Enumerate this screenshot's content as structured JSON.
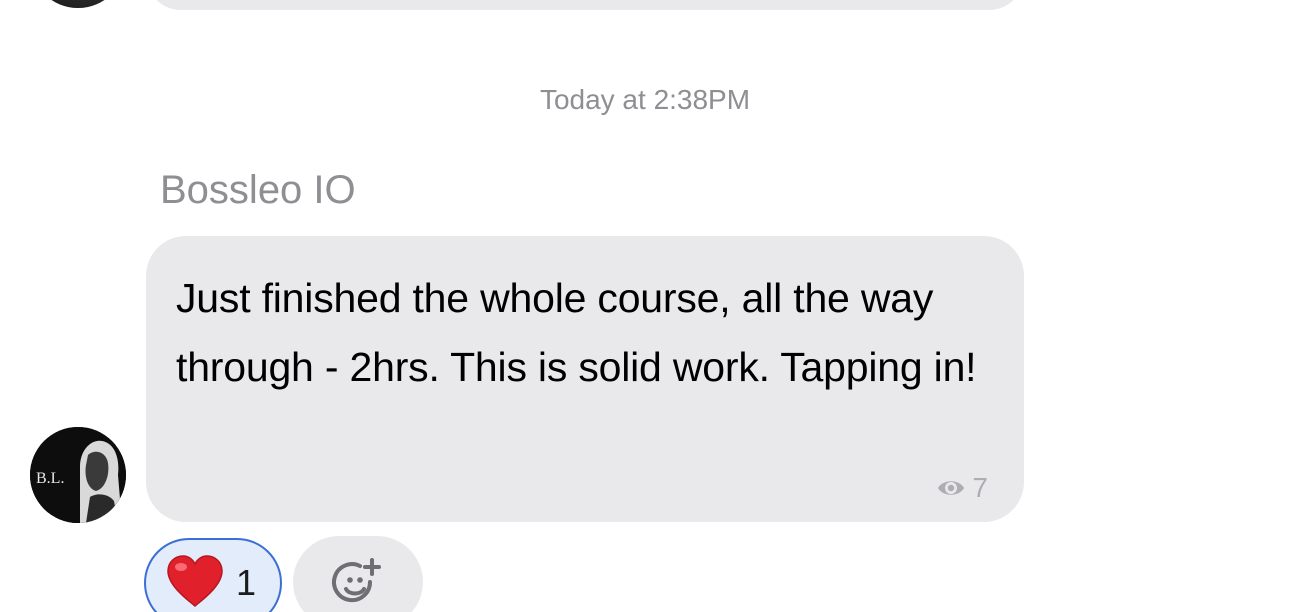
{
  "conversation": {
    "timestamp": "Today at 2:38PM",
    "message": {
      "sender": "Bossleo IO",
      "text": "Just finished the whole course, all the way through - 2hrs. This is solid work. Tapping in!",
      "view_count": "7",
      "avatar_initials": "B.L."
    },
    "reactions": [
      {
        "emoji": "heart-emoji",
        "count": "1",
        "selected": true
      }
    ],
    "add_reaction_icon": "add-reaction-icon"
  },
  "colors": {
    "bubble": "#e9e9eb",
    "secondary_text": "#8e8e93",
    "reaction_selected_border": "#3b6fd4",
    "reaction_selected_bg": "#e3ecfb",
    "heart": "#e0202b"
  }
}
